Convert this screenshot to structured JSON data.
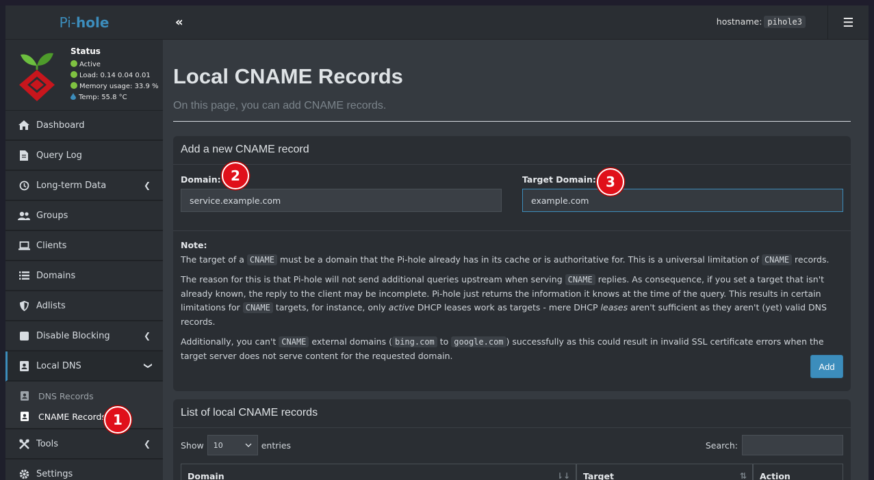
{
  "brand": {
    "part1": "Pi-",
    "part2": "hole"
  },
  "status": {
    "title": "Status",
    "active": "Active",
    "load": "Load:  0.14  0.04  0.01",
    "memory": "Memory usage:  33.9 %",
    "temp": "Temp: 55.8 °C"
  },
  "sidebar": {
    "items": [
      {
        "label": "Dashboard",
        "icon": "home-icon"
      },
      {
        "label": "Query Log",
        "icon": "file-icon"
      },
      {
        "label": "Long-term Data",
        "icon": "history-icon"
      },
      {
        "label": "Groups",
        "icon": "users-icon"
      },
      {
        "label": "Clients",
        "icon": "laptop-icon"
      },
      {
        "label": "Domains",
        "icon": "list-icon"
      },
      {
        "label": "Adlists",
        "icon": "shield-icon"
      },
      {
        "label": "Disable Blocking",
        "icon": "stop-icon"
      },
      {
        "label": "Local DNS",
        "icon": "address-book-icon"
      },
      {
        "label": "Tools",
        "icon": "tools-icon"
      },
      {
        "label": "Settings",
        "icon": "gear-icon"
      }
    ],
    "sub_items": [
      {
        "label": "DNS Records"
      },
      {
        "label": "CNAME Records"
      }
    ]
  },
  "header": {
    "hostname_label": "hostname:",
    "hostname_value": "pihole3",
    "toggle": "«",
    "menu": "☰"
  },
  "page": {
    "title": "Local CNAME Records",
    "subtitle": "On this page, you can add CNAME records."
  },
  "add_card": {
    "title": "Add a new CNAME record",
    "domain_label": "Domain:",
    "domain_value": "service.example.com",
    "target_label": "Target Domain:",
    "target_value": "example.com",
    "note_title": "Note:",
    "note1_a": "The target of a ",
    "note1_code1": "CNAME",
    "note1_b": " must be a domain that the Pi-hole already has in its cache or is authoritative for. This is a universal limitation of ",
    "note1_code2": "CNAME",
    "note1_c": " records.",
    "note2_a": "The reason for this is that Pi-hole will not send additional queries upstream when serving ",
    "note2_code1": "CNAME",
    "note2_b": " replies. As consequence, if you set a target that isn't already known, the reply to the client may be incomplete. Pi-hole just returns the information it knows at the time of the query. This results in certain limitations for ",
    "note2_code2": "CNAME",
    "note2_c": " targets, for instance, only ",
    "note2_em1": "active",
    "note2_d": " DHCP leases work as targets - mere DHCP ",
    "note2_em2": "leases",
    "note2_e": " aren't sufficient as they aren't (yet) valid DNS records.",
    "note3_a": "Additionally, you can't ",
    "note3_code1": "CNAME",
    "note3_b": " external domains (",
    "note3_code2": "bing.com",
    "note3_c": " to ",
    "note3_code3": "google.com",
    "note3_d": ") successfully as this could result in invalid SSL certificate errors when the target server does not serve content for the requested domain.",
    "add_label": "Add"
  },
  "list_card": {
    "title": "List of local CNAME records",
    "show_label": "Show",
    "entries_value": "10",
    "entries_label": "entries",
    "search_label": "Search:",
    "columns": [
      "Domain",
      "Target",
      "Action"
    ]
  },
  "markers": [
    "1",
    "2",
    "3"
  ],
  "colors": {
    "accent": "#3c8dbc",
    "marker": "#e0101a",
    "status_ok": "#7fc241"
  }
}
